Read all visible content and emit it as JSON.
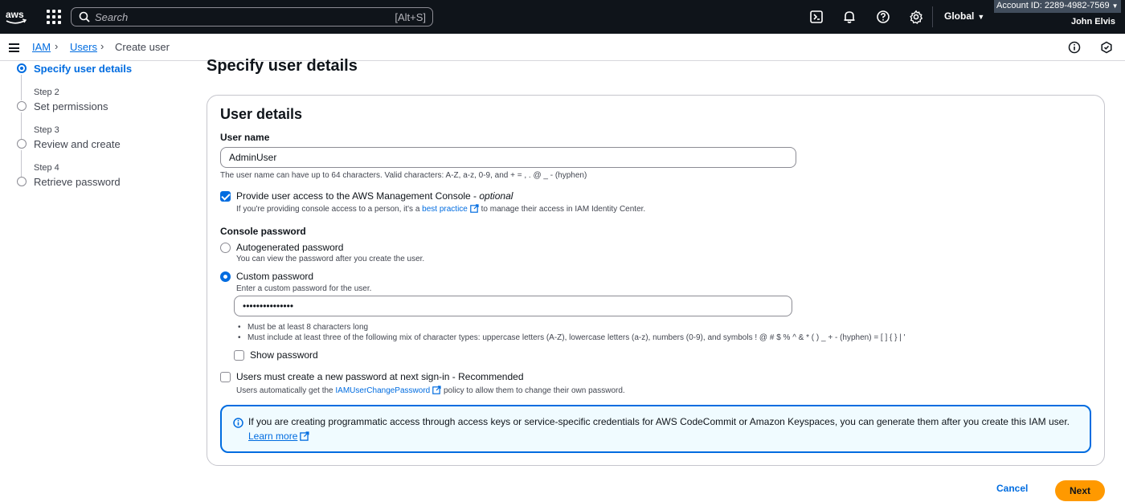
{
  "topnav": {
    "search_placeholder": "Search",
    "search_shortcut": "[Alt+S]",
    "region": "Global",
    "account_id": "Account ID: 2289-4982-7569",
    "user": "John Elvis"
  },
  "breadcrumb": {
    "items": [
      "IAM",
      "Users"
    ],
    "current": "Create user"
  },
  "steps": [
    {
      "small": "",
      "title": "Specify user details",
      "active": true
    },
    {
      "small": "Step 2",
      "title": "Set permissions",
      "active": false
    },
    {
      "small": "Step 3",
      "title": "Review and create",
      "active": false
    },
    {
      "small": "Step 4",
      "title": "Retrieve password",
      "active": false
    }
  ],
  "main": {
    "page_title": "Specify user details",
    "card_title": "User details",
    "username_label": "User name",
    "username_value": "AdminUser",
    "username_hint": "The user name can have up to 64 characters. Valid characters: A-Z, a-z, 0-9, and + = , . @ _ - (hyphen)",
    "console_access": {
      "checked": true,
      "label": "Provide user access to the AWS Management Console - ",
      "label_optional": "optional",
      "hint_before": "If you're providing console access to a person, it's a ",
      "hint_link": "best practice",
      "hint_after": " to manage their access in IAM Identity Center."
    },
    "password_label": "Console password",
    "auto_password": {
      "label": "Autogenerated password",
      "hint": "You can view the password after you create the user.",
      "selected": false
    },
    "custom_password": {
      "label": "Custom password",
      "hint": "Enter a custom password for the user.",
      "selected": true,
      "value": "•••••••••••••••"
    },
    "password_rules": [
      "Must be at least 8 characters long",
      "Must include at least three of the following mix of character types: uppercase letters (A-Z), lowercase letters (a-z), numbers (0-9), and symbols ! @ # $ % ^ & * ( ) _ + - (hyphen) = [ ] { } | '"
    ],
    "show_password": {
      "label": "Show password",
      "checked": false
    },
    "reset_required": {
      "label": "Users must create a new password at next sign-in - Recommended",
      "checked": false,
      "hint_before": "Users automatically get the ",
      "hint_link": "IAMUserChangePassword",
      "hint_after": " policy to allow them to change their own password."
    },
    "info": {
      "text": "If you are creating programmatic access through access keys or service-specific credentials for AWS CodeCommit or Amazon Keyspaces, you can generate them after you create this IAM user.",
      "link": "Learn more"
    }
  },
  "footer": {
    "cancel": "Cancel",
    "next": "Next"
  },
  "colors": {
    "accent": "#006ce0",
    "primary_button": "#ff9900",
    "nav_bg": "#0f141a"
  }
}
